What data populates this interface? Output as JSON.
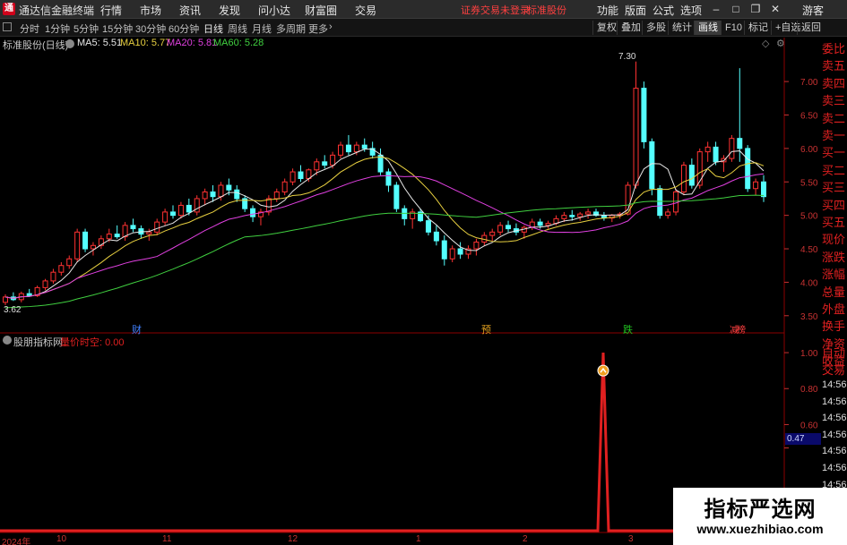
{
  "window": {
    "title": "通达信金融终端",
    "logo_glyph": "通",
    "menu": [
      "行情",
      "市场",
      "资讯",
      "发现",
      "问小达",
      "财富圈",
      "交易"
    ],
    "alert": "证券交易未登录",
    "stock_tag": "标准股份",
    "right_menu": [
      "功能",
      "版面",
      "公式",
      "选项"
    ],
    "user": "游客"
  },
  "toolbar": {
    "periods": [
      "分时",
      "1分钟",
      "5分钟",
      "15分钟",
      "30分钟",
      "60分钟",
      "日线",
      "周线",
      "月线",
      "多周期",
      "更多"
    ],
    "active_period": "日线",
    "tools": [
      "复权",
      "叠加",
      "多股",
      "统计",
      "画线",
      "F10",
      "标记",
      "+自选",
      "返回"
    ]
  },
  "main_chart": {
    "stock_label": "标准股份(日线)",
    "ma": [
      {
        "label": "MA5: 5.51",
        "color": "#e8e8e8"
      },
      {
        "label": "MA10: 5.77",
        "color": "#e8d040"
      },
      {
        "label": "MA20: 5.81",
        "color": "#e040e0"
      },
      {
        "label": "MA60: 5.28",
        "color": "#40d040"
      }
    ],
    "high_label": "7.30",
    "low_label": "3.62",
    "event_markers": [
      {
        "text": "财",
        "color": "#4080ff"
      },
      {
        "text": "预",
        "color": "#e0a020"
      },
      {
        "text": "跌",
        "color": "#20c020"
      },
      {
        "text": "减",
        "color": "#ff4040"
      },
      {
        "text": "榜",
        "color": "#ff4040"
      }
    ]
  },
  "indicator": {
    "name": "股朋指标网",
    "formula": "量价时空: 0.00",
    "current_value": "0.47"
  },
  "right_panel": {
    "labels": [
      "委比",
      "卖五",
      "卖四",
      "卖三",
      "卖二",
      "卖一",
      "买一",
      "买二",
      "买三",
      "买四",
      "买五",
      "现价",
      "涨跌",
      "涨幅",
      "总量",
      "外盘",
      "换手",
      "净资",
      "收益",
      "自动",
      "交易"
    ],
    "times": [
      "14:56",
      "14:56",
      "14:56",
      "14:56",
      "14:56",
      "14:56",
      "14:56",
      "14:56",
      "14:56",
      "14:56"
    ]
  },
  "x_axis": {
    "labels": [
      "2024年",
      "10",
      "11",
      "12",
      "1",
      "2",
      "3"
    ]
  },
  "watermark": {
    "title": "指标严选网",
    "url": "www.xuezhibiao.com"
  },
  "chart_data": [
    {
      "type": "line",
      "title": "",
      "y_ticks": [
        3.5,
        4.0,
        4.5,
        5.0,
        5.5,
        6.0,
        6.5,
        7.0
      ],
      "ylim": [
        3.35,
        7.55
      ],
      "candles": [
        [
          3.7,
          3.82,
          3.66,
          3.78
        ],
        [
          3.78,
          3.85,
          3.72,
          3.74
        ],
        [
          3.74,
          3.86,
          3.7,
          3.83
        ],
        [
          3.83,
          3.9,
          3.78,
          3.8
        ],
        [
          3.8,
          3.95,
          3.78,
          3.92
        ],
        [
          3.92,
          4.05,
          3.88,
          4.02
        ],
        [
          4.02,
          4.2,
          3.98,
          4.15
        ],
        [
          4.15,
          4.3,
          4.1,
          4.25
        ],
        [
          4.25,
          4.4,
          4.2,
          4.35
        ],
        [
          4.35,
          4.8,
          4.3,
          4.75
        ],
        [
          4.75,
          4.8,
          4.45,
          4.5
        ],
        [
          4.5,
          4.6,
          4.4,
          4.55
        ],
        [
          4.55,
          4.7,
          4.5,
          4.65
        ],
        [
          4.65,
          4.8,
          4.6,
          4.72
        ],
        [
          4.72,
          4.85,
          4.65,
          4.68
        ],
        [
          4.68,
          4.9,
          4.62,
          4.85
        ],
        [
          4.85,
          4.95,
          4.75,
          4.8
        ],
        [
          4.8,
          4.85,
          4.65,
          4.72
        ],
        [
          4.72,
          4.8,
          4.62,
          4.75
        ],
        [
          4.75,
          4.95,
          4.7,
          4.9
        ],
        [
          4.9,
          5.1,
          4.85,
          5.05
        ],
        [
          5.05,
          5.15,
          4.95,
          5.0
        ],
        [
          5.0,
          5.2,
          4.95,
          5.15
        ],
        [
          5.15,
          5.25,
          5.0,
          5.05
        ],
        [
          5.05,
          5.3,
          5.0,
          5.25
        ],
        [
          5.25,
          5.4,
          5.15,
          5.35
        ],
        [
          5.35,
          5.45,
          5.2,
          5.28
        ],
        [
          5.28,
          5.5,
          5.22,
          5.45
        ],
        [
          5.45,
          5.55,
          5.3,
          5.38
        ],
        [
          5.38,
          5.45,
          5.2,
          5.25
        ],
        [
          5.25,
          5.3,
          5.05,
          5.1
        ],
        [
          5.1,
          5.15,
          4.9,
          4.98
        ],
        [
          4.98,
          5.1,
          4.85,
          5.05
        ],
        [
          5.05,
          5.3,
          5.0,
          5.25
        ],
        [
          5.25,
          5.4,
          5.2,
          5.35
        ],
        [
          5.35,
          5.55,
          5.3,
          5.5
        ],
        [
          5.5,
          5.7,
          5.45,
          5.65
        ],
        [
          5.65,
          5.75,
          5.5,
          5.55
        ],
        [
          5.55,
          5.7,
          5.5,
          5.68
        ],
        [
          5.68,
          5.85,
          5.6,
          5.8
        ],
        [
          5.8,
          5.9,
          5.7,
          5.75
        ],
        [
          5.75,
          5.95,
          5.7,
          5.9
        ],
        [
          5.9,
          6.1,
          5.85,
          6.05
        ],
        [
          6.05,
          6.2,
          5.9,
          5.95
        ],
        [
          5.95,
          6.1,
          5.9,
          6.05
        ],
        [
          6.05,
          6.15,
          5.95,
          6.0
        ],
        [
          6.0,
          6.1,
          5.85,
          5.9
        ],
        [
          5.9,
          6.0,
          5.6,
          5.65
        ],
        [
          5.65,
          5.7,
          5.35,
          5.45
        ],
        [
          5.45,
          5.5,
          5.05,
          5.1
        ],
        [
          5.1,
          5.15,
          4.85,
          4.95
        ],
        [
          4.95,
          5.1,
          4.8,
          5.05
        ],
        [
          5.05,
          5.1,
          4.9,
          4.92
        ],
        [
          4.92,
          5.0,
          4.7,
          4.75
        ],
        [
          4.75,
          4.85,
          4.55,
          4.62
        ],
        [
          4.62,
          4.7,
          4.25,
          4.35
        ],
        [
          4.35,
          4.55,
          4.3,
          4.5
        ],
        [
          4.5,
          4.6,
          4.35,
          4.42
        ],
        [
          4.42,
          4.55,
          4.35,
          4.5
        ],
        [
          4.5,
          4.65,
          4.4,
          4.6
        ],
        [
          4.6,
          4.75,
          4.55,
          4.7
        ],
        [
          4.7,
          4.8,
          4.62,
          4.75
        ],
        [
          4.75,
          4.9,
          4.7,
          4.85
        ],
        [
          4.85,
          4.92,
          4.75,
          4.8
        ],
        [
          4.8,
          4.88,
          4.7,
          4.75
        ],
        [
          4.75,
          4.85,
          4.65,
          4.82
        ],
        [
          4.82,
          4.95,
          4.78,
          4.9
        ],
        [
          4.9,
          4.95,
          4.8,
          4.85
        ],
        [
          4.85,
          4.92,
          4.8,
          4.88
        ],
        [
          4.88,
          5.0,
          4.85,
          4.95
        ],
        [
          4.95,
          5.05,
          4.9,
          5.0
        ],
        [
          5.0,
          5.08,
          4.92,
          4.98
        ],
        [
          4.98,
          5.05,
          4.92,
          5.02
        ],
        [
          5.02,
          5.1,
          4.95,
          5.05
        ],
        [
          5.05,
          5.1,
          4.98,
          5.0
        ],
        [
          5.0,
          5.05,
          4.92,
          4.96
        ],
        [
          4.96,
          5.02,
          4.9,
          5.0
        ],
        [
          5.0,
          5.05,
          4.95,
          5.02
        ],
        [
          5.02,
          5.5,
          5.0,
          5.45
        ],
        [
          5.45,
          7.3,
          5.4,
          6.9
        ],
        [
          6.9,
          7.0,
          6.0,
          6.1
        ],
        [
          6.1,
          6.15,
          5.3,
          5.4
        ],
        [
          5.4,
          5.45,
          4.95,
          5.0
        ],
        [
          5.0,
          5.1,
          4.95,
          5.05
        ],
        [
          5.05,
          5.4,
          5.0,
          5.35
        ],
        [
          5.35,
          5.8,
          5.3,
          5.75
        ],
        [
          5.75,
          5.85,
          5.4,
          5.45
        ],
        [
          5.45,
          6.0,
          5.4,
          5.95
        ],
        [
          5.95,
          6.1,
          5.8,
          6.02
        ],
        [
          6.02,
          6.1,
          5.75,
          5.8
        ],
        [
          5.8,
          5.9,
          5.65,
          5.85
        ],
        [
          5.85,
          6.2,
          5.8,
          6.15
        ],
        [
          6.15,
          7.2,
          5.8,
          6.0
        ],
        [
          6.0,
          6.05,
          5.35,
          5.4
        ],
        [
          5.4,
          5.55,
          5.3,
          5.5
        ],
        [
          5.5,
          5.6,
          5.2,
          5.28
        ]
      ]
    },
    {
      "type": "line",
      "title": "",
      "y_ticks": [
        0.47,
        0.6,
        0.8,
        1.0
      ],
      "ylim": [
        0.0,
        1.06
      ],
      "pulse_index": 74,
      "values_note_hidden": ""
    }
  ]
}
